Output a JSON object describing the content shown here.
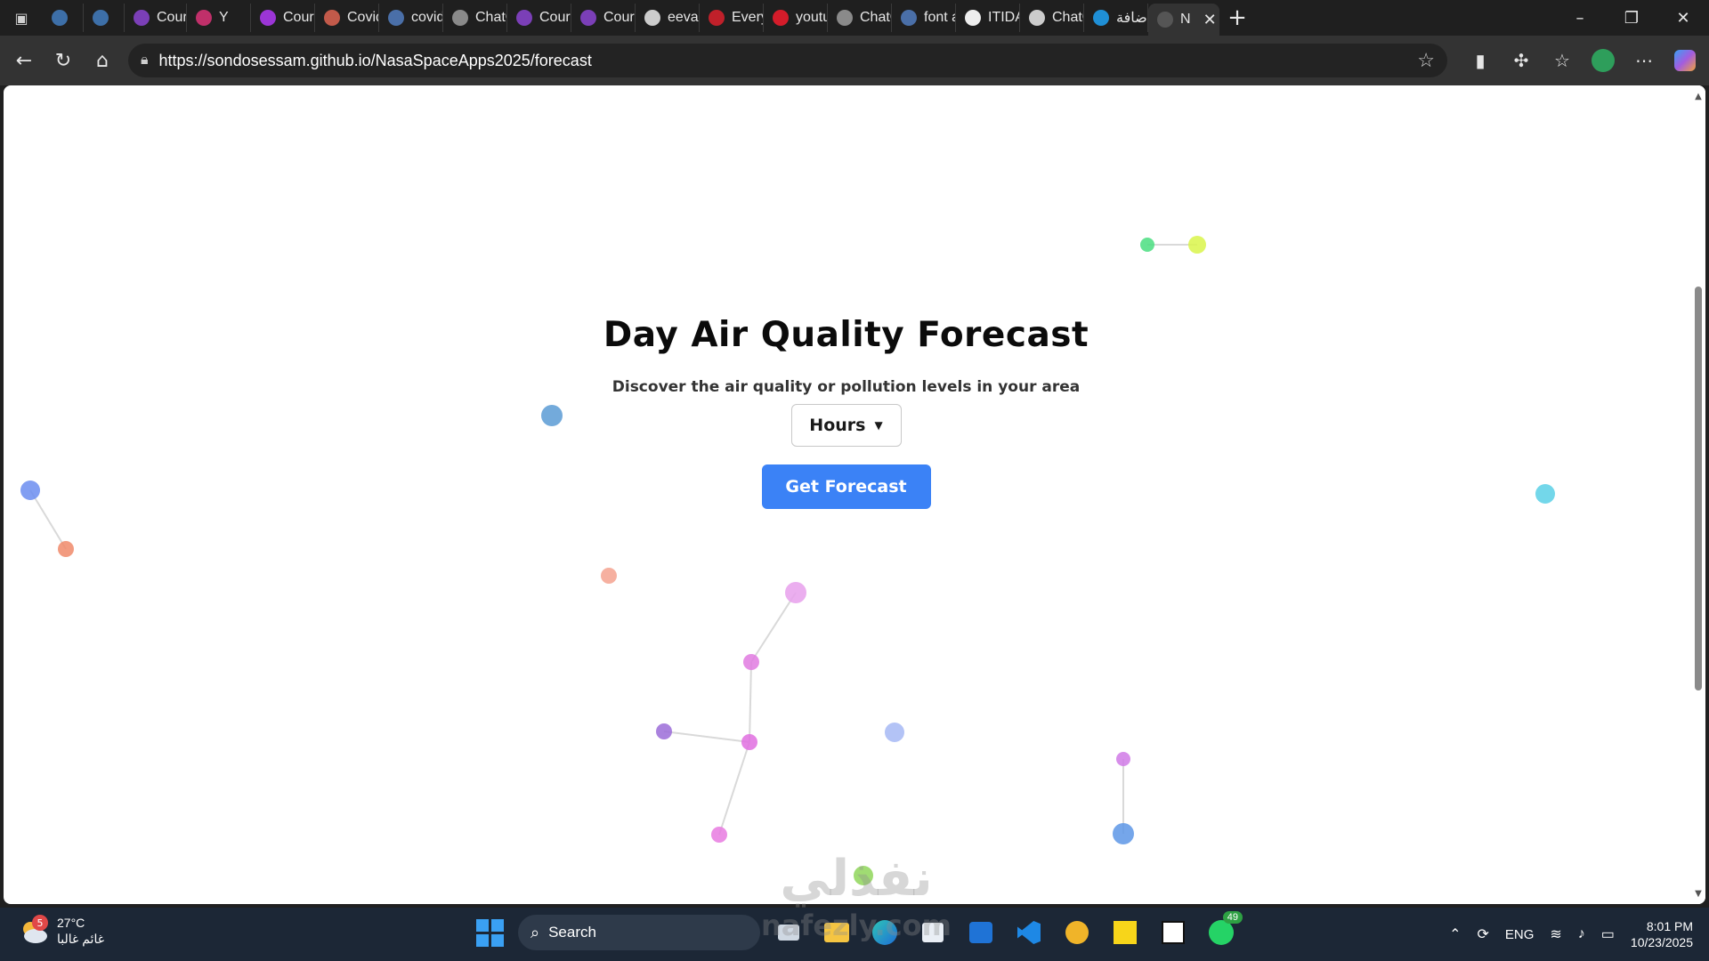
{
  "browser": {
    "tabs": [
      {
        "label": "",
        "fav_color": "#3d6fa8"
      },
      {
        "label": "",
        "fav_color": "#3d6fa8"
      },
      {
        "label": "Course",
        "fav_color": "#7b3fb7"
      },
      {
        "label": "Y",
        "fav_color": "#c0306a"
      },
      {
        "label": "Course",
        "fav_color": "#9b35d6"
      },
      {
        "label": "Covid",
        "fav_color": "#c25a4a"
      },
      {
        "label": "covid",
        "fav_color": "#4a6fa8"
      },
      {
        "label": "ChatG",
        "fav_color": "#8a8a8a"
      },
      {
        "label": "Course",
        "fav_color": "#7b3fb7"
      },
      {
        "label": "Course",
        "fav_color": "#7b3fb7"
      },
      {
        "label": "eevan",
        "fav_color": "#cccccc"
      },
      {
        "label": "Every",
        "fav_color": "#c0202a"
      },
      {
        "label": "youtub",
        "fav_color": "#d41c2a"
      },
      {
        "label": "ChatG",
        "fav_color": "#8a8a8a"
      },
      {
        "label": "font av",
        "fav_color": "#4a6fa8"
      },
      {
        "label": "ITIDA",
        "fav_color": "#eeeeee"
      },
      {
        "label": "ChatG",
        "fav_color": "#cccccc"
      },
      {
        "label": "إضافة",
        "fav_color": "#1f8fd6"
      },
      {
        "label": "N",
        "fav_color": "#555555",
        "active": true
      }
    ],
    "address": {
      "url": "https://sondosessam.github.io/NasaSpaceApps2025/forecast"
    }
  },
  "page": {
    "title": "Day Air Quality Forecast",
    "subtitle": "Discover the air quality or pollution levels in your area",
    "select": {
      "value": "Hours",
      "options": [
        "Hours"
      ]
    },
    "button_label": "Get Forecast"
  },
  "particles": [
    {
      "c": "#4ade80"
    },
    {
      "c": "#d9f54a"
    },
    {
      "c": "#5b9bd5"
    },
    {
      "c": "#6b8df0"
    },
    {
      "c": "#f08a6a"
    },
    {
      "c": "#f4a28f"
    },
    {
      "c": "#e7a0ec"
    },
    {
      "c": "#e07ae0"
    },
    {
      "c": "#9b6cd8"
    },
    {
      "c": "#e06ee0"
    },
    {
      "c": "#a6b8f4"
    },
    {
      "c": "#e77ae0"
    },
    {
      "c": "#d07ae6"
    },
    {
      "c": "#5d97e6"
    },
    {
      "c": "#5ad0e6"
    },
    {
      "c": "#8fd65a"
    }
  ],
  "watermark": {
    "arabic": "نفذلي",
    "latin": "nafezly.com"
  },
  "taskbar": {
    "weather": {
      "temp": "27°C",
      "desc": "غائم غالبا",
      "badge": "5"
    },
    "search_label": "Search",
    "whatsapp_badge": "49",
    "lang": "ENG",
    "time": "8:01 PM",
    "date": "10/23/2025"
  }
}
